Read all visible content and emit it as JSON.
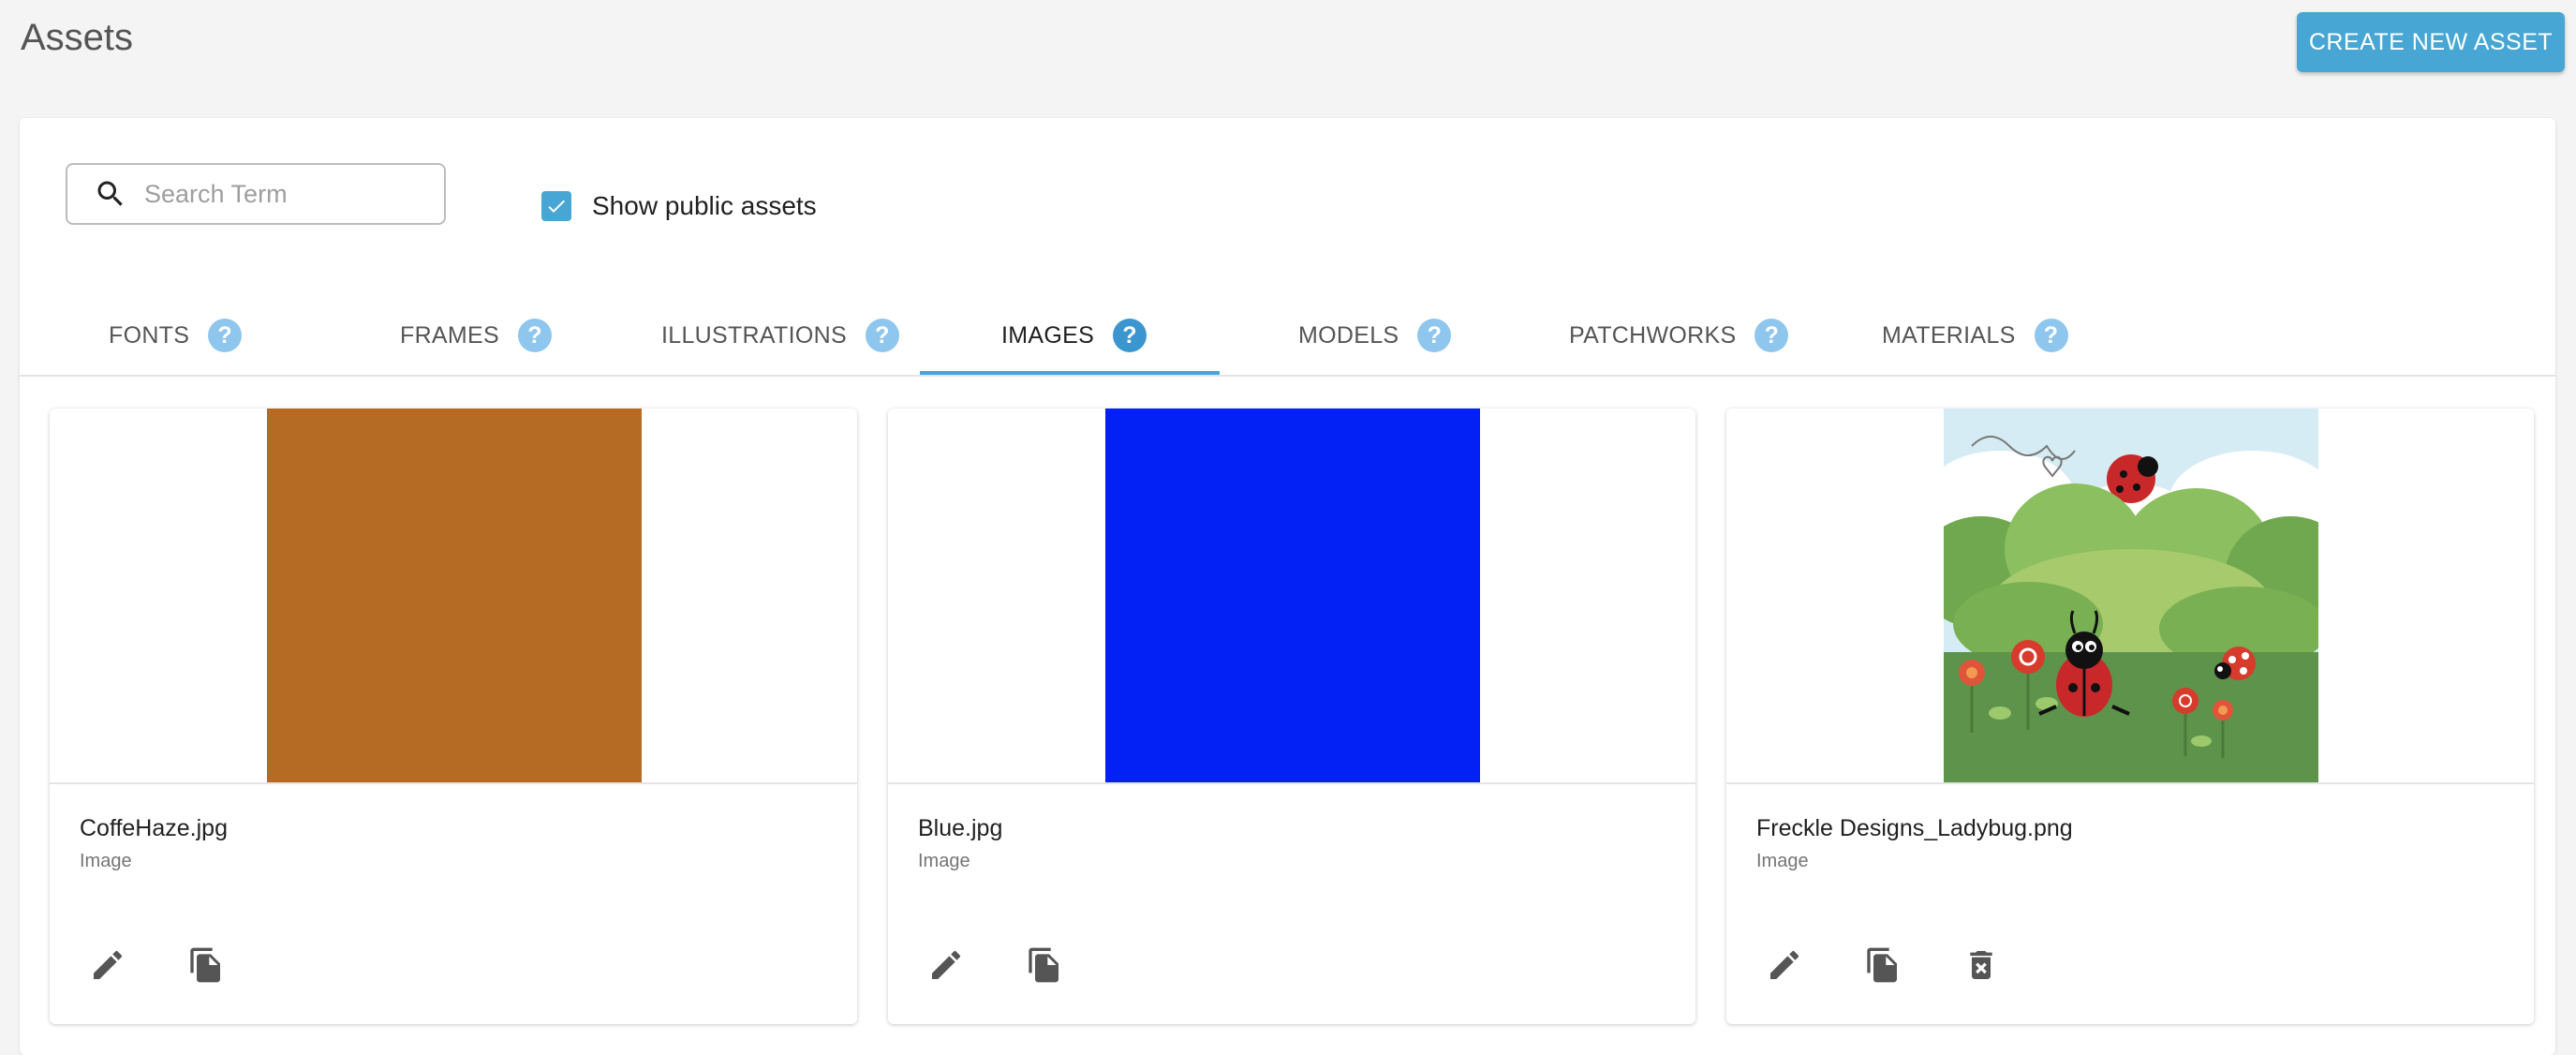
{
  "header": {
    "title": "Assets",
    "create_label": "CREATE NEW ASSET"
  },
  "search": {
    "placeholder": "Search Term",
    "value": ""
  },
  "public_toggle": {
    "label": "Show public assets",
    "checked": true
  },
  "tabs": [
    {
      "label": "FONTS",
      "active": false
    },
    {
      "label": "FRAMES",
      "active": false
    },
    {
      "label": "ILLUSTRATIONS",
      "active": false
    },
    {
      "label": "IMAGES",
      "active": true
    },
    {
      "label": "MODELS",
      "active": false
    },
    {
      "label": "PATCHWORKS",
      "active": false
    },
    {
      "label": "MATERIALS",
      "active": false
    }
  ],
  "help_glyph": "?",
  "cards": [
    {
      "name": "CoffeHaze.jpg",
      "type": "Image",
      "thumb_color": "#b56b24",
      "actions": [
        "edit-icon",
        "copy-icon"
      ]
    },
    {
      "name": "Blue.jpg",
      "type": "Image",
      "thumb_color": "#0421f5",
      "actions": [
        "edit-icon",
        "copy-icon"
      ]
    },
    {
      "name": "Freckle Designs_Ladybug.png",
      "type": "Image",
      "thumb_illustration": "ladybug-garden",
      "actions": [
        "edit-icon",
        "copy-icon",
        "delete-icon"
      ]
    }
  ],
  "colors": {
    "accent": "#47a6d3",
    "help_icon": "#8fc6ee"
  }
}
